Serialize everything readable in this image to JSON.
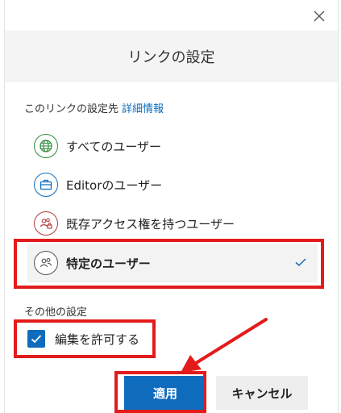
{
  "dialog": {
    "title": "リンクの設定",
    "subhead": "このリンクの設定先",
    "subhead_link": "詳細情報",
    "options": [
      {
        "label": "すべてのユーザー",
        "icon": "globe-icon",
        "color": "#2e8b3a"
      },
      {
        "label": "Editorのユーザー",
        "icon": "briefcase-icon",
        "color": "#0f6cbd"
      },
      {
        "label": "既存アクセス権を持つユーザー",
        "icon": "people-lock-icon",
        "color": "#b33a3a"
      },
      {
        "label": "特定のユーザー",
        "icon": "people-icon",
        "color": "#555555",
        "selected": true
      }
    ],
    "other_settings_title": "その他の設定",
    "allow_edit_label": "編集を許可する",
    "allow_edit_checked": true,
    "apply_label": "適用",
    "cancel_label": "キャンセル"
  },
  "colors": {
    "accent": "#0f6cbd",
    "highlight": "#e31b1b"
  }
}
